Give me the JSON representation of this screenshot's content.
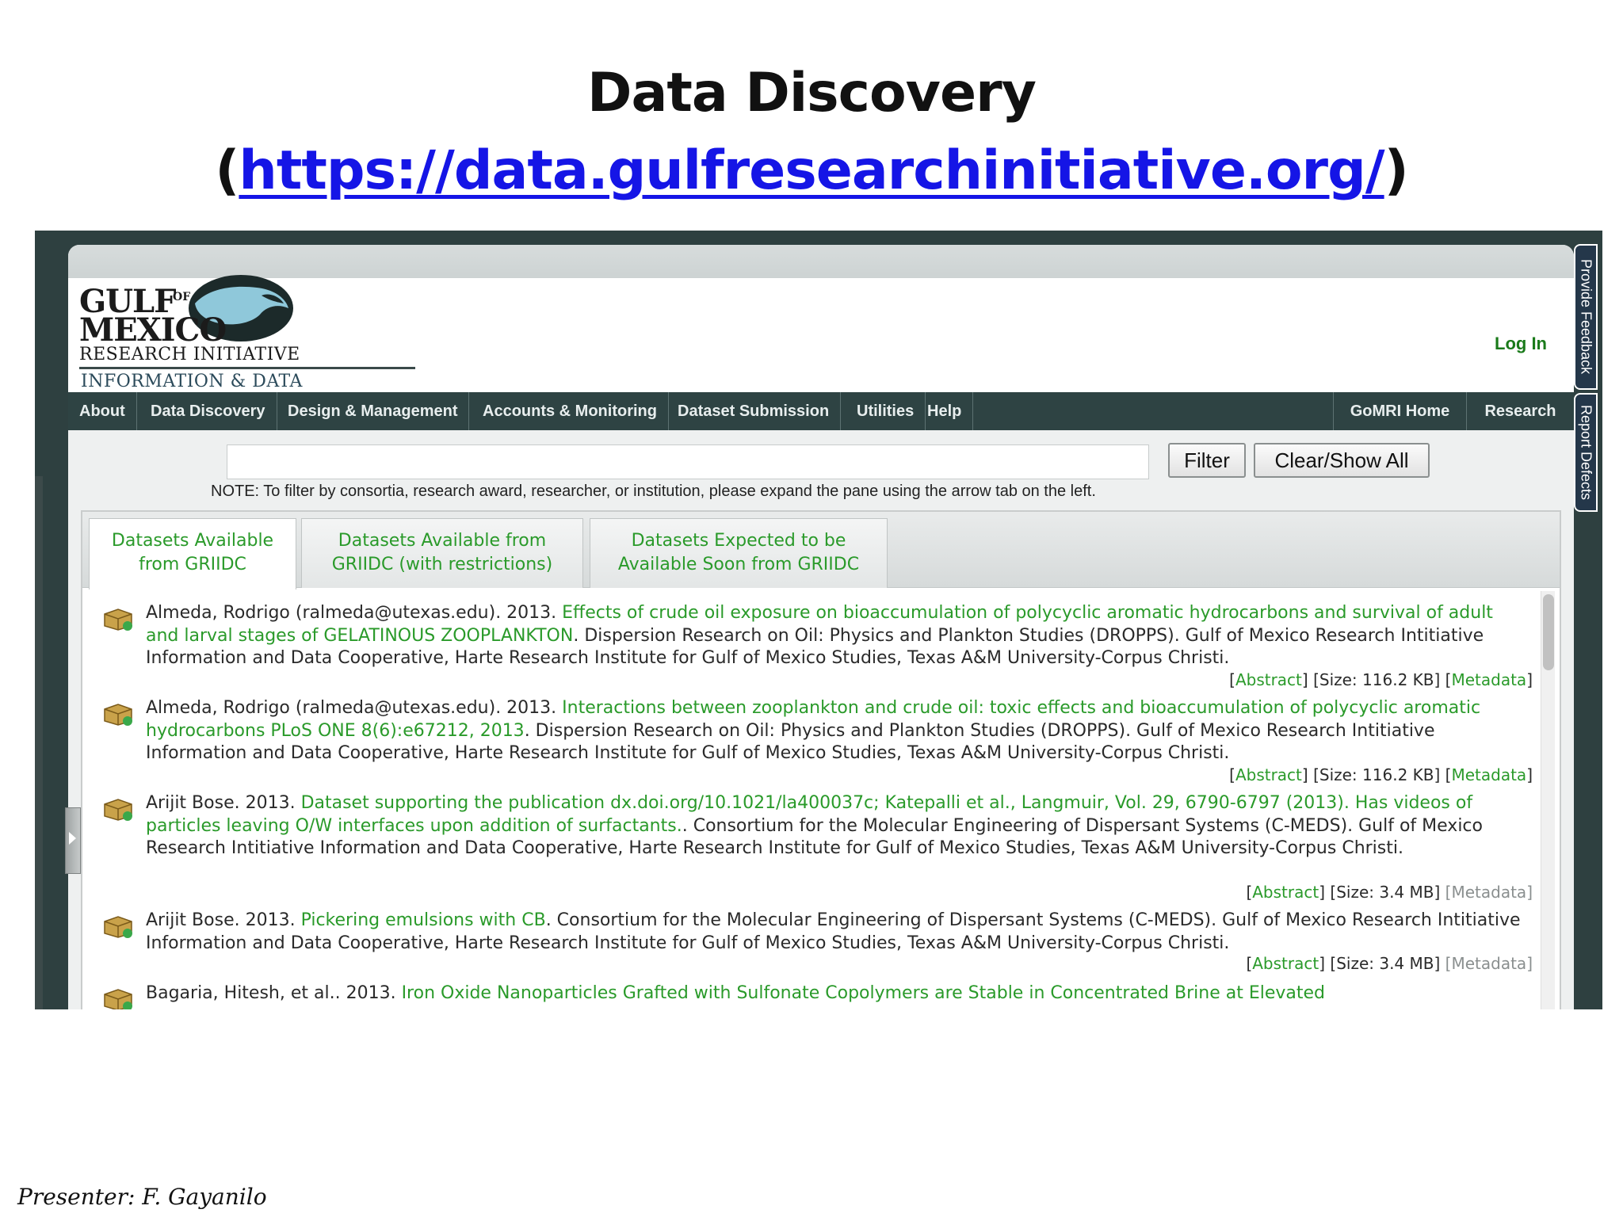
{
  "slide": {
    "title": "Data Discovery",
    "url_open": "(",
    "url_text": "https://data.gulfresearchinitiative.org/",
    "url_close": ")",
    "presenter": "Presenter: F. Gayanilo"
  },
  "logo": {
    "gulf": "GULF",
    "of": "OF",
    "mexico": "MEXICO",
    "research_initiative": "RESEARCH INITIATIVE",
    "info_coop": "INFORMATION & DATA COOPERATIVE"
  },
  "header": {
    "login": "Log In"
  },
  "nav": {
    "left": [
      "About",
      "Data Discovery",
      "Design & Management",
      "Accounts & Monitoring",
      "Dataset Submission",
      "Utilities",
      "Help"
    ],
    "right": [
      "GoMRI Home",
      "Research"
    ]
  },
  "filter": {
    "input_value": "",
    "filter_button": "Filter",
    "clear_button": "Clear/Show All",
    "note": "NOTE: To filter by consortia, research award, researcher, or institution, please expand the pane using the arrow tab on the left."
  },
  "tabs": [
    {
      "line1": "Datasets Available",
      "line2": "from GRIIDC"
    },
    {
      "line1": "Datasets Available from",
      "line2": "GRIIDC (with restrictions)"
    },
    {
      "line1": "Datasets Expected to be",
      "line2": "Available Soon from GRIIDC"
    }
  ],
  "records": [
    {
      "author": "Almeda, Rodrigo (ralmeda@utexas.edu). 2013. ",
      "title": "Effects of crude oil exposure on bioaccumulation of polycyclic aromatic hydrocarbons and survival of adult and larval stages of GELATINOUS ZOOPLANKTON",
      "rest": ". Dispersion Research on Oil: Physics and Plankton Studies (DROPPS). Gulf of Mexico Research Intitiative Information and Data Cooperative, Harte Research Institute for Gulf of Mexico Studies, Texas A&M University-Corpus Christi.",
      "abstract": "Abstract",
      "size": "[Size: 116.2 KB]",
      "metadata": "Metadata"
    },
    {
      "author": "Almeda, Rodrigo (ralmeda@utexas.edu). 2013. ",
      "title": "Interactions between zooplankton and crude oil: toxic effects and bioaccumulation of polycyclic aromatic hydrocarbons PLoS ONE 8(6):e67212, 2013",
      "rest": ". Dispersion Research on Oil: Physics and Plankton Studies (DROPPS). Gulf of Mexico Research Intitiative Information and Data Cooperative, Harte Research Institute for Gulf of Mexico Studies, Texas A&M University-Corpus Christi.",
      "abstract": "Abstract",
      "size": "[Size: 116.2 KB]",
      "metadata": "Metadata"
    },
    {
      "author": "Arijit Bose. 2013. ",
      "title": "Dataset supporting the publication dx.doi.org/10.1021/la400037c; Katepalli et al., Langmuir, Vol. 29, 6790-6797 (2013). Has videos of particles leaving O/W interfaces upon addition of surfactants.",
      "rest": ". Consortium for the Molecular Engineering of Dispersant Systems (C-MEDS). Gulf of Mexico Research Intitiative Information and Data Cooperative, Harte Research Institute for Gulf of Mexico Studies, Texas A&M University-Corpus Christi.",
      "abstract": "Abstract",
      "size": "[Size: 3.4 MB]",
      "metadata": "Metadata"
    },
    {
      "author": "Arijit Bose. 2013. ",
      "title": "Pickering emulsions with CB",
      "rest": ". Consortium for the Molecular Engineering of Dispersant Systems (C-MEDS). Gulf of Mexico Research Intitiative Information and Data Cooperative, Harte Research Institute for Gulf of Mexico Studies, Texas A&M University-Corpus Christi.",
      "abstract": "Abstract",
      "size": "[Size: 3.4 MB]",
      "metadata": "Metadata"
    },
    {
      "author": "Bagaria, Hitesh, et al.. 2013. ",
      "title": "Iron Oxide Nanoparticles Grafted with Sulfonate Copolymers are Stable in Concentrated Brine at Elevated",
      "rest": "",
      "abstract": "",
      "size": "",
      "metadata": ""
    }
  ],
  "side_tabs": {
    "feedback": "Provide Feedback",
    "defects": "Report Defects"
  },
  "icons": {
    "dataset": "dataset-package-icon",
    "expand": "expand-arrow-icon"
  },
  "colors": {
    "link_green": "#2a9a2a",
    "nav_bg": "#2e4343",
    "url_blue": "#1515e6",
    "side_tab": "#24374a"
  }
}
